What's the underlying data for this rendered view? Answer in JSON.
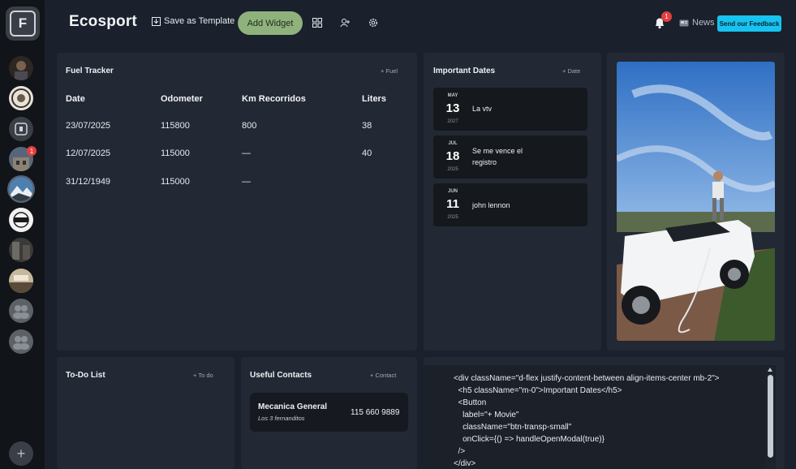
{
  "app": {
    "title": "Ecosport"
  },
  "toolbar": {
    "save_template_label": "Save as Template",
    "add_widget_label": "Add Widget",
    "notification_count": "1",
    "news_label": "News",
    "feedback_label": "Send our Feedback"
  },
  "rail": {
    "logo_letter": "F",
    "badge_count": "1",
    "add_label": "+"
  },
  "fuel_tracker": {
    "title": "Fuel Tracker",
    "add_label": "+ Fuel",
    "columns": [
      "Date",
      "Odometer",
      "Km Recorridos",
      "Liters"
    ],
    "rows": [
      [
        "23/07/2025",
        "115800",
        "800",
        "38"
      ],
      [
        "12/07/2025",
        "115000",
        "—",
        "40"
      ],
      [
        "31/12/1949",
        "115000",
        "—",
        ""
      ]
    ]
  },
  "important_dates": {
    "title": "Important Dates",
    "add_label": "+ Date",
    "items": [
      {
        "month": "MAY",
        "day": "13",
        "year": "2027",
        "label": "La vtv"
      },
      {
        "month": "JUL",
        "day": "18",
        "year": "2025",
        "label": "Se me vence el registro"
      },
      {
        "month": "JUN",
        "day": "11",
        "year": "2025",
        "label": "john lennon"
      }
    ]
  },
  "todo": {
    "title": "To-Do List",
    "add_label": "+ To do"
  },
  "contacts": {
    "title": "Useful Contacts",
    "add_label": "+ Contact",
    "items": [
      {
        "name": "Mecanica General",
        "subtitle": "Los 3 fernanditos",
        "phone": "115 660 9889"
      }
    ]
  },
  "code_block": {
    "lines": [
      "<div className=\"d-flex justify-content-between align-items-center mb-2\">",
      "  <h5 className=\"m-0\">Important Dates</h5>",
      "  <Button",
      "    label=\"+ Movie\"",
      "    className=\"btn-transp-small\"",
      "    onClick={() => handleOpenModal(true)}",
      "  />",
      "</div>"
    ]
  },
  "colors": {
    "background": "#1a202c",
    "panel": "#222834",
    "accent_green": "#8fb27d",
    "feedback_blue": "#17c3f0",
    "badge_red": "#e53e3e"
  }
}
